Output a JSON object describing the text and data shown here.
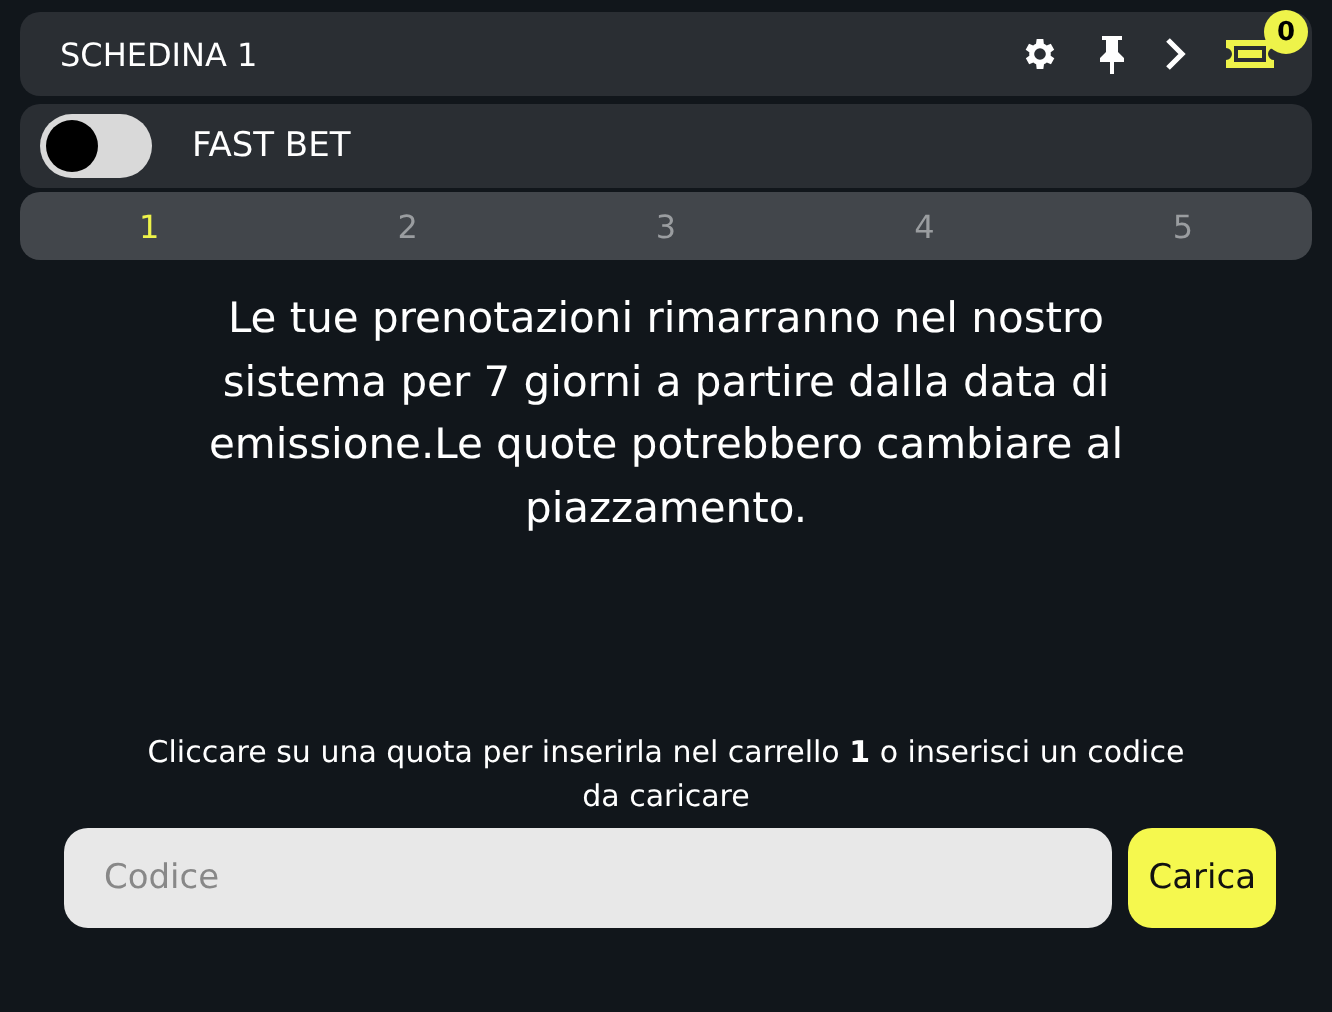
{
  "header": {
    "title": "SCHEDINA 1",
    "badge": "0"
  },
  "fast_bet": {
    "label": "FAST BET",
    "on": false
  },
  "tabs": [
    {
      "label": "1",
      "selected": true
    },
    {
      "label": "2",
      "selected": false
    },
    {
      "label": "3",
      "selected": false
    },
    {
      "label": "4",
      "selected": false
    },
    {
      "label": "5",
      "selected": false
    }
  ],
  "message": "Le tue prenotazioni rimarranno nel nostro sistema per 7 giorni a partire dalla data di emissione.Le quote potrebbero cambiare al piazzamento.",
  "hint": "Cliccare su una quota per inserirla nel carrello **1** o inserisci un codice da caricare",
  "code_field": {
    "placeholder": "Codice"
  },
  "load_button": "Carica"
}
